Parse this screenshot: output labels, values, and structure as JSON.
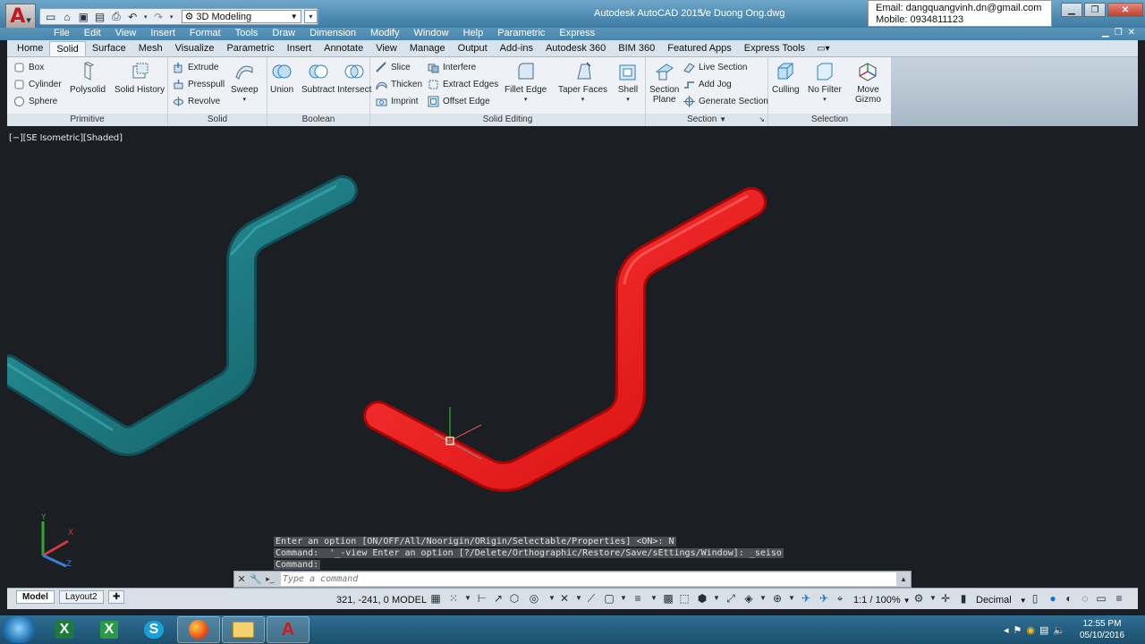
{
  "titlebar": {
    "app_letter": "A",
    "workspace": "3D Modeling",
    "app_title": "Autodesk AutoCAD 2015",
    "file_name": "Ve Duong Ong.dwg",
    "contact_email": "Email: dangquangvinh.dn@gmail.com",
    "contact_mobile": "Mobile: 0934811123"
  },
  "menu": [
    "File",
    "Edit",
    "View",
    "Insert",
    "Format",
    "Tools",
    "Draw",
    "Dimension",
    "Modify",
    "Window",
    "Help",
    "Parametric",
    "Express"
  ],
  "ribbon_tabs": [
    "Home",
    "Solid",
    "Surface",
    "Mesh",
    "Visualize",
    "Parametric",
    "Insert",
    "Annotate",
    "View",
    "Manage",
    "Output",
    "Add-ins",
    "Autodesk 360",
    "BIM 360",
    "Featured Apps",
    "Express Tools"
  ],
  "ribbon_active_tab": "Solid",
  "panels": {
    "primitive": {
      "title": "Primitive",
      "box": "Box",
      "cylinder": "Cylinder",
      "sphere": "Sphere",
      "polysolid": "Polysolid",
      "solid_history": "Solid History"
    },
    "solid": {
      "title": "Solid",
      "extrude": "Extrude",
      "presspull": "Presspull",
      "revolve": "Revolve",
      "sweep": "Sweep"
    },
    "boolean": {
      "title": "Boolean",
      "union": "Union",
      "subtract": "Subtract",
      "intersect": "Intersect"
    },
    "solid_editing": {
      "title": "Solid Editing",
      "slice": "Slice",
      "thicken": "Thicken",
      "imprint": "Imprint",
      "interfere": "Interfere",
      "extract_edges": "Extract Edges",
      "offset_edge": "Offset Edge",
      "fillet_edge": "Fillet Edge",
      "taper_faces": "Taper Faces",
      "shell": "Shell"
    },
    "section": {
      "title": "Section",
      "section_plane_1": "Section",
      "section_plane_2": "Plane",
      "live_section": "Live Section",
      "add_jog": "Add Jog",
      "generate_section": "Generate Section"
    },
    "selection": {
      "title": "Selection",
      "culling": "Culling",
      "no_filter": "No Filter",
      "move_gizmo_1": "Move",
      "move_gizmo_2": "Gizmo"
    }
  },
  "viewport": {
    "label": "[−][SE Isometric][Shaded]",
    "colors": {
      "pipe_teal": "#1c7f86",
      "pipe_red": "#ee1111",
      "background": "#1b1e23"
    }
  },
  "command": {
    "history": [
      "Enter an option [ON/OFF/All/Noorigin/ORigin/Selectable/Properties] <ON>: N",
      "Command:  '_-view Enter an option [?/Delete/Orthographic/Restore/Save/sEttings/Window]: _seiso",
      "Command:"
    ],
    "placeholder": "Type a command"
  },
  "layout_tabs": [
    "Model",
    "Layout2"
  ],
  "status": {
    "coords": "321, -241, 0",
    "space": "MODEL",
    "scale": "1:1 / 100%",
    "units": "Decimal"
  },
  "taskbar": {
    "apps": [
      "excel-icon",
      "excel-file-icon",
      "skype-icon",
      "firefox-icon",
      "folder-icon",
      "autocad-icon"
    ],
    "time": "12:55 PM",
    "date": "05/10/2016"
  }
}
